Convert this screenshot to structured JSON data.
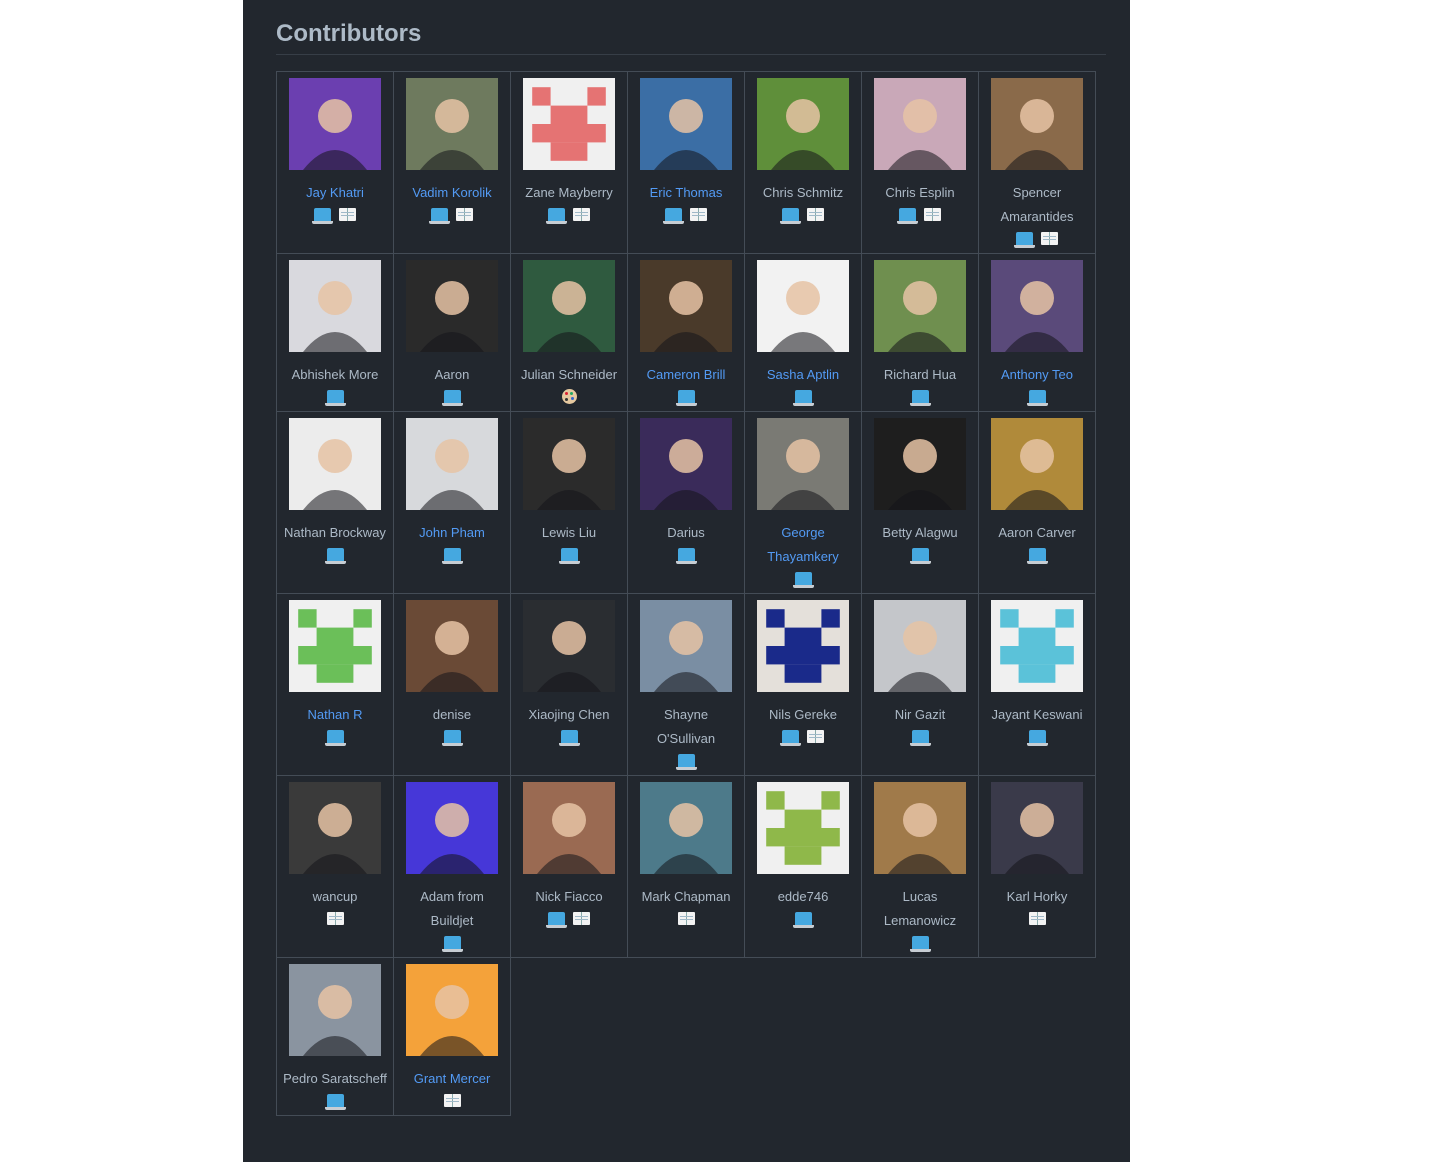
{
  "page": {
    "title": "Contributors"
  },
  "legend": {
    "code": "💻",
    "doc": "📖",
    "design": "🎨"
  },
  "contributors": [
    {
      "name": "Jay Khatri",
      "link": true,
      "contribs": [
        "code",
        "doc"
      ],
      "bg": "#6b3fb0"
    },
    {
      "name": "Vadim Korolik",
      "link": true,
      "contribs": [
        "code",
        "doc"
      ],
      "bg": "#6e7a5e"
    },
    {
      "name": "Zane Mayberry",
      "link": false,
      "contribs": [
        "code",
        "doc"
      ],
      "bg": "#f0f0f0",
      "fg": "#e57373"
    },
    {
      "name": "Eric Thomas",
      "link": true,
      "contribs": [
        "code",
        "doc"
      ],
      "bg": "#3b6ea5"
    },
    {
      "name": "Chris Schmitz",
      "link": false,
      "contribs": [
        "code",
        "doc"
      ],
      "bg": "#5f8f3a"
    },
    {
      "name": "Chris Esplin",
      "link": false,
      "contribs": [
        "code",
        "doc"
      ],
      "bg": "#c9a8b8"
    },
    {
      "name": "Spencer Amarantides",
      "link": false,
      "contribs": [
        "code",
        "doc"
      ],
      "bg": "#8a6a4a"
    },
    {
      "name": "Abhishek More",
      "link": false,
      "contribs": [
        "code"
      ],
      "bg": "#d9d9de"
    },
    {
      "name": "Aaron",
      "link": false,
      "contribs": [
        "code"
      ],
      "bg": "#2a2a2a"
    },
    {
      "name": "Julian Schneider",
      "link": false,
      "contribs": [
        "design"
      ],
      "bg": "#2f5a3f"
    },
    {
      "name": "Cameron Brill",
      "link": true,
      "contribs": [
        "code"
      ],
      "bg": "#4a3a2a"
    },
    {
      "name": "Sasha Aptlin",
      "link": true,
      "contribs": [
        "code"
      ],
      "bg": "#f2f2f2"
    },
    {
      "name": "Richard Hua",
      "link": false,
      "contribs": [
        "code"
      ],
      "bg": "#6f8f4f"
    },
    {
      "name": "Anthony Teo",
      "link": true,
      "contribs": [
        "code"
      ],
      "bg": "#5a4a7a"
    },
    {
      "name": "Nathan Brockway",
      "link": false,
      "contribs": [
        "code"
      ],
      "bg": "#ececec"
    },
    {
      "name": "John Pham",
      "link": true,
      "contribs": [
        "code"
      ],
      "bg": "#d7d9dc"
    },
    {
      "name": "Lewis Liu",
      "link": false,
      "contribs": [
        "code"
      ],
      "bg": "#2b2b2b"
    },
    {
      "name": "Darius",
      "link": false,
      "contribs": [
        "code"
      ],
      "bg": "#3a2b5a"
    },
    {
      "name": "George Thayamkery",
      "link": true,
      "contribs": [
        "code"
      ],
      "bg": "#7a7a74"
    },
    {
      "name": "Betty Alagwu",
      "link": false,
      "contribs": [
        "code"
      ],
      "bg": "#1e1e1e"
    },
    {
      "name": "Aaron Carver",
      "link": false,
      "contribs": [
        "code"
      ],
      "bg": "#b08a3a"
    },
    {
      "name": "Nathan R",
      "link": true,
      "contribs": [
        "code"
      ],
      "bg": "#f0f0f0",
      "fg": "#6bbf59"
    },
    {
      "name": "denise",
      "link": false,
      "contribs": [
        "code"
      ],
      "bg": "#6a4a36"
    },
    {
      "name": "Xiaojing Chen",
      "link": false,
      "contribs": [
        "code"
      ],
      "bg": "#2a2d31"
    },
    {
      "name": "Shayne O'Sullivan",
      "link": false,
      "contribs": [
        "code"
      ],
      "bg": "#7a8ea3"
    },
    {
      "name": "Nils Gereke",
      "link": false,
      "contribs": [
        "code",
        "doc"
      ],
      "bg": "#e4e0da",
      "fg": "#1a2a8a"
    },
    {
      "name": "Nir Gazit",
      "link": false,
      "contribs": [
        "code"
      ],
      "bg": "#c4c6ca"
    },
    {
      "name": "Jayant Keswani",
      "link": false,
      "contribs": [
        "code"
      ],
      "bg": "#f0f0f0",
      "fg": "#5bc2d9"
    },
    {
      "name": "wancup",
      "link": false,
      "contribs": [
        "doc"
      ],
      "bg": "#3a3a3a"
    },
    {
      "name": "Adam from Buildjet",
      "link": false,
      "contribs": [
        "code"
      ],
      "bg": "#4637d8"
    },
    {
      "name": "Nick Fiacco",
      "link": false,
      "contribs": [
        "code",
        "doc"
      ],
      "bg": "#9a6a52"
    },
    {
      "name": "Mark Chapman",
      "link": false,
      "contribs": [
        "doc"
      ],
      "bg": "#4d7a8a"
    },
    {
      "name": "edde746",
      "link": false,
      "contribs": [
        "code"
      ],
      "bg": "#f0f0f0",
      "fg": "#8fb84a"
    },
    {
      "name": "Lucas Lemanowicz",
      "link": false,
      "contribs": [
        "code"
      ],
      "bg": "#a07a4a"
    },
    {
      "name": "Karl Horky",
      "link": false,
      "contribs": [
        "doc"
      ],
      "bg": "#3a3a4a"
    },
    {
      "name": "Pedro Saratscheff",
      "link": false,
      "contribs": [
        "code"
      ],
      "bg": "#8a94a0"
    },
    {
      "name": "Grant Mercer",
      "link": true,
      "contribs": [
        "doc"
      ],
      "bg": "#f4a23a"
    }
  ]
}
